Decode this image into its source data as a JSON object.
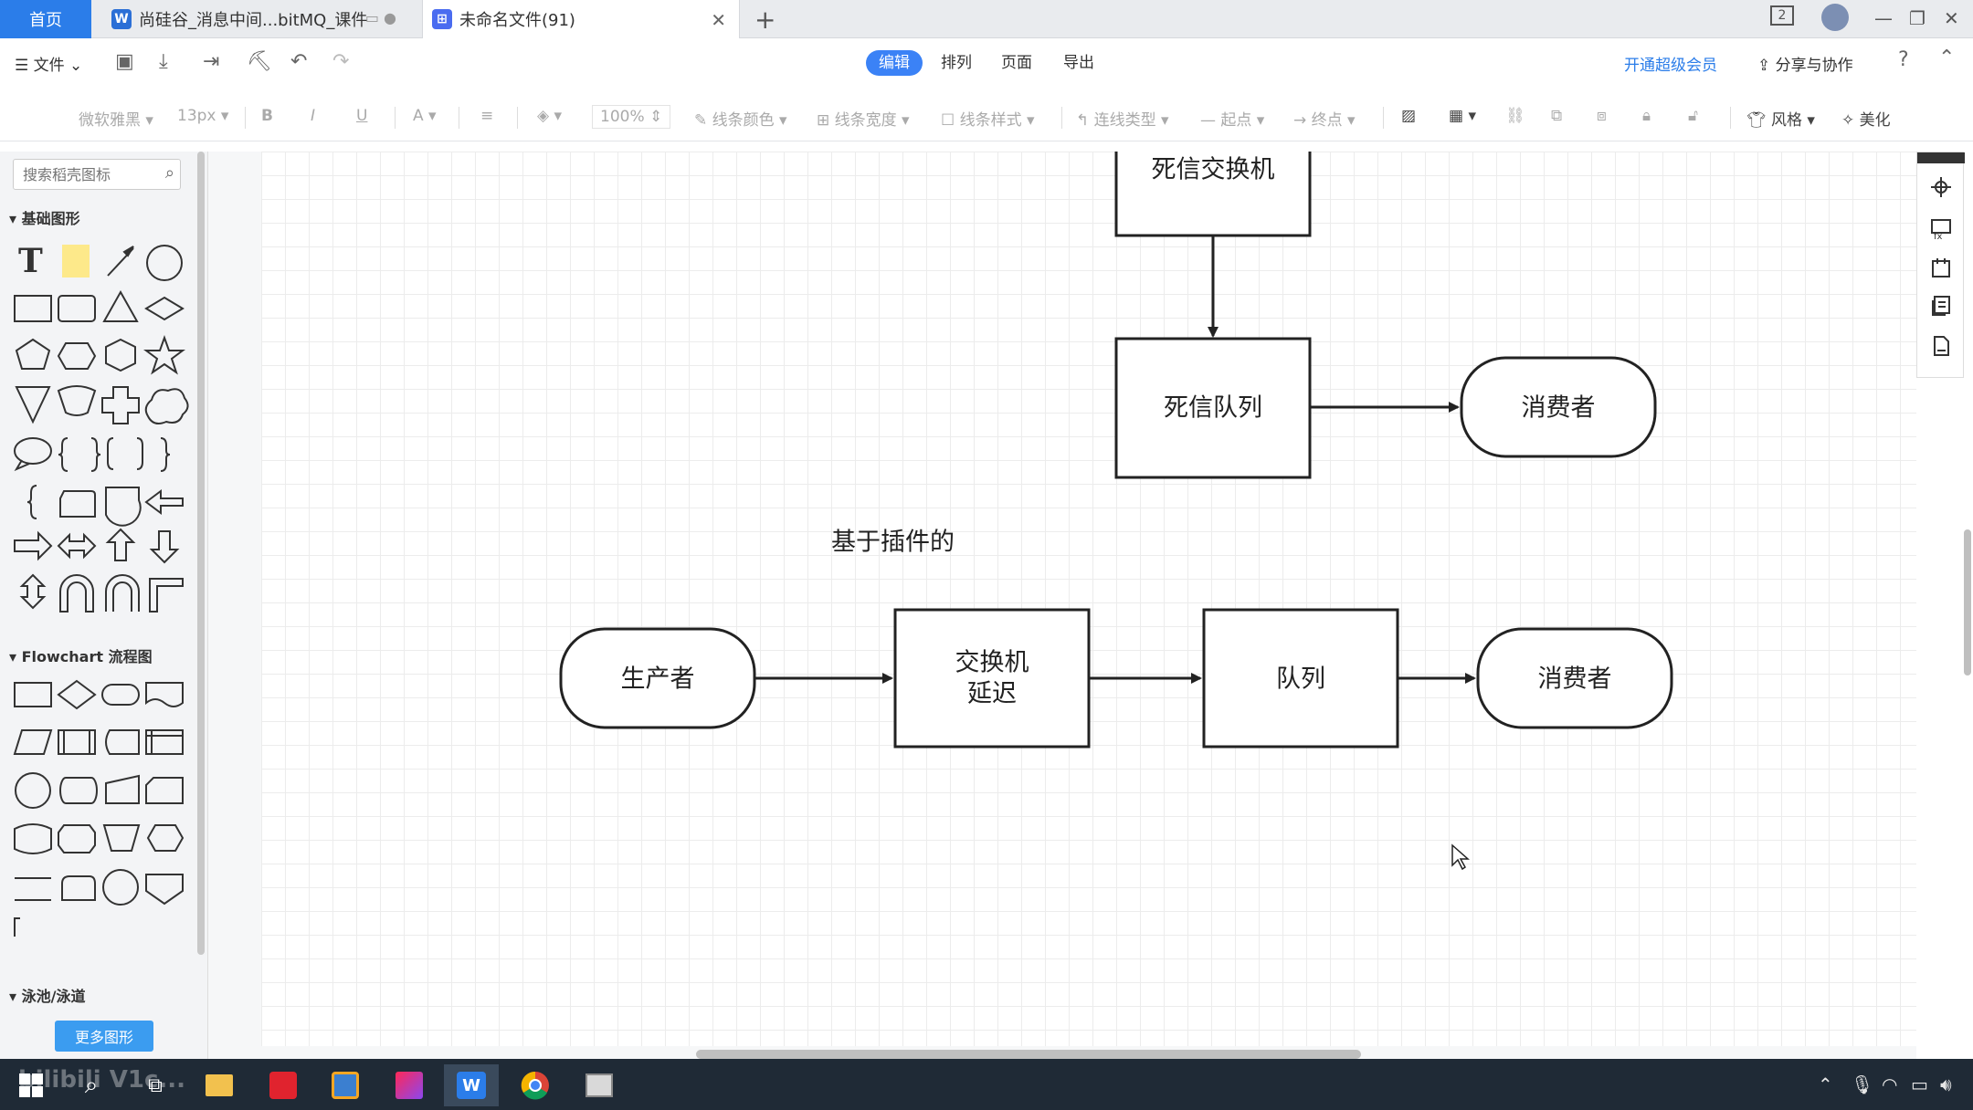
{
  "tabs": {
    "home": "首页",
    "doc": "尚硅谷_消息中间...bitMQ_课件",
    "file": "未命名文件(91)",
    "window_badge": "2"
  },
  "menu": {
    "file": "文件",
    "modes": [
      "编辑",
      "排列",
      "页面",
      "导出"
    ],
    "vip": "开通超级会员",
    "share": "分享与协作"
  },
  "toolbar": {
    "font": "微软雅黑",
    "font_size": "13px",
    "zoom": "100%",
    "line_color": "线条颜色",
    "line_width": "线条宽度",
    "line_style": "线条样式",
    "connector_type": "连线类型",
    "start": "起点",
    "end": "终点",
    "style": "风格",
    "beautify": "美化"
  },
  "left_panel": {
    "search_placeholder": "搜索稻壳图标",
    "sections": {
      "basic": "基础图形",
      "flowchart": "Flowchart 流程图",
      "swimlane": "泳池/泳道"
    },
    "more_shapes": "更多图形"
  },
  "diagram": {
    "dlx_exchange": "死信交换机",
    "dlx_queue": "死信队列",
    "consumer_top": "消费者",
    "plugin_caption": "基于插件的",
    "producer": "生产者",
    "exchange_line1": "交换机",
    "exchange_line2": "延迟",
    "queue": "队列",
    "consumer_bottom": "消费者"
  },
  "taskbar": {
    "watermark": "bilibili  V1c..."
  }
}
